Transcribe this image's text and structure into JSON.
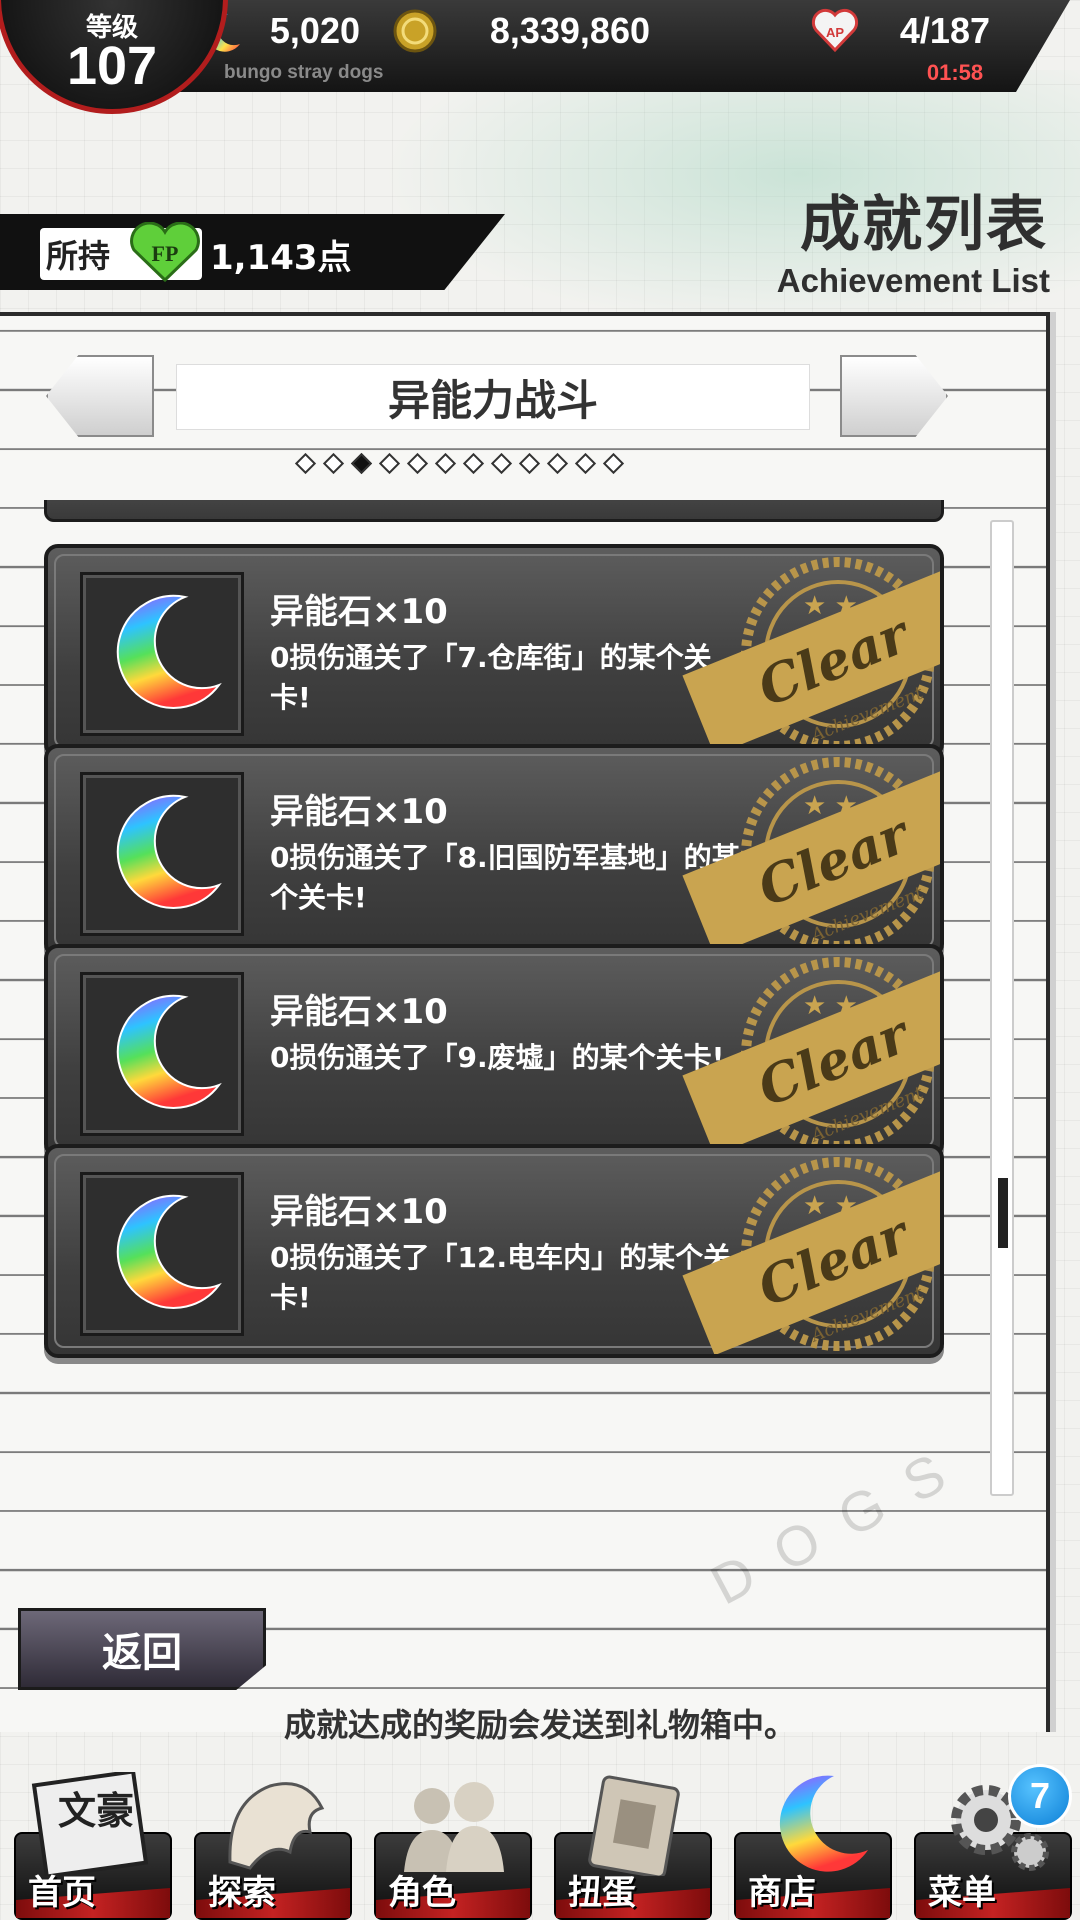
{
  "header": {
    "level_label": "等级",
    "level_value": "107",
    "stones": "5,020",
    "coins": "8,339,860",
    "ap": "4/187",
    "ap_timer": "01:58",
    "subtitle": "bungo stray dogs",
    "ap_icon_text": "AP"
  },
  "page": {
    "title": "成就列表",
    "subtitle": "Achievement List"
  },
  "points": {
    "label": "所持",
    "icon_text": "FP",
    "value": "1,143点"
  },
  "category": {
    "title": "异能力战斗",
    "page_count": 12,
    "active_index": 2
  },
  "achievements": [
    {
      "reward": "异能石×10",
      "desc": "0损伤通关了「7.仓库街」的某个关卡!",
      "status": "Clear",
      "status_sub": "Achievement"
    },
    {
      "reward": "异能石×10",
      "desc": "0损伤通关了「8.旧国防军基地」的某个关卡!",
      "status": "Clear",
      "status_sub": "Achievement"
    },
    {
      "reward": "异能石×10",
      "desc": "0损伤通关了「9.废墟」的某个关卡!",
      "status": "Clear",
      "status_sub": "Achievement"
    },
    {
      "reward": "异能石×10",
      "desc": "0损伤通关了「12.电车内」的某个关卡!",
      "status": "Clear",
      "status_sub": "Achievement"
    }
  ],
  "footer": {
    "back_label": "返回",
    "note": "成就达成的奖励会发送到礼物箱中。",
    "watermark": "DOGS"
  },
  "nav": [
    {
      "label": "首页",
      "icon": "home-emblem-icon",
      "art_text": "文豪"
    },
    {
      "label": "探索",
      "icon": "tiger-icon"
    },
    {
      "label": "角色",
      "icon": "characters-icon"
    },
    {
      "label": "扭蛋",
      "icon": "book-icon"
    },
    {
      "label": "商店",
      "icon": "crescent-stone-icon"
    },
    {
      "label": "菜单",
      "icon": "gear-icon"
    }
  ],
  "menu_badge": "7",
  "colors": {
    "accent_red": "#b21d1d",
    "clear_gold": "#c9a450",
    "badge_blue": "#0c7fd6",
    "points_green": "#5fcf3a"
  }
}
